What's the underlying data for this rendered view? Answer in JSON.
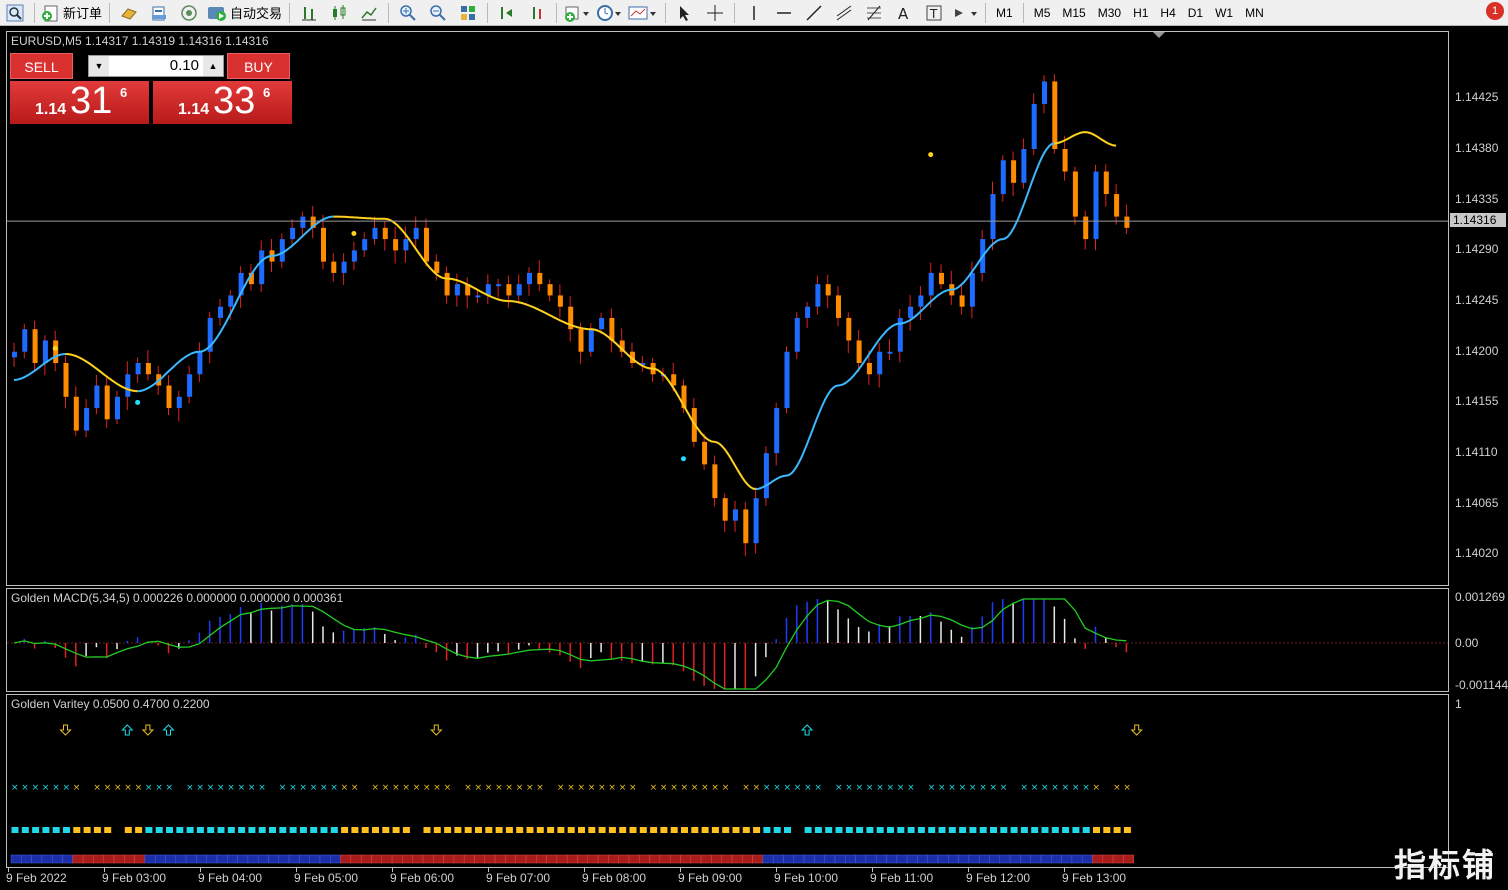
{
  "toolbar": {
    "new_order_label": "新订单",
    "auto_trading_label": "自动交易",
    "timeframes": [
      "M1",
      "M5",
      "M15",
      "M30",
      "H1",
      "H4",
      "D1",
      "W1",
      "MN"
    ],
    "notification_count": "1",
    "colors": {
      "background": "#f0f0f0",
      "badge": "#d93025"
    }
  },
  "chart": {
    "title": "EURUSD,M5  1.14317 1.14319 1.14316 1.14316",
    "current_price": "1.14316",
    "price_labels": [
      "1.14425",
      "1.14380",
      "1.14335",
      "1.14290",
      "1.14245",
      "1.14200",
      "1.14155",
      "1.14110",
      "1.14065",
      "1.14020"
    ],
    "colors": {
      "bull": "#1e6bff",
      "bear": "#ff8c00",
      "wick": "#e0231d",
      "ma_up": "#3cb8ff",
      "ma_down": "#ffd21e"
    }
  },
  "trade_panel": {
    "sell_label": "SELL",
    "buy_label": "BUY",
    "volume": "0.10",
    "sell_small": "1.14",
    "sell_big": "31",
    "sell_sup": "6",
    "buy_small": "1.14",
    "buy_big": "33",
    "buy_sup": "6"
  },
  "macd": {
    "title": "Golden MACD(5,34,5) 0.000226 0.000000 0.000000 0.000361",
    "labels": [
      "0.001269",
      "0.00",
      "-0.001144"
    ]
  },
  "variety": {
    "title": "Golden Varitey 0.0500 0.4700 0.2200",
    "scale_label": "1"
  },
  "time_axis": {
    "labels": [
      "9 Feb 2022",
      "9 Feb 03:00",
      "9 Feb 04:00",
      "9 Feb 05:00",
      "9 Feb 06:00",
      "9 Feb 07:00",
      "9 Feb 08:00",
      "9 Feb 09:00",
      "9 Feb 10:00",
      "9 Feb 11:00",
      "9 Feb 12:00",
      "9 Feb 13:00"
    ]
  },
  "watermark": "指标铺",
  "chart_data": {
    "type": "candlestick",
    "symbol": "EURUSD",
    "timeframe": "M5",
    "y_range": [
      1.14,
      1.14475
    ],
    "closes": [
      1.142,
      1.1422,
      1.1419,
      1.1421,
      1.1419,
      1.1416,
      1.1413,
      1.1415,
      1.1417,
      1.1414,
      1.1416,
      1.1418,
      1.1419,
      1.1418,
      1.1417,
      1.1415,
      1.1416,
      1.1418,
      1.142,
      1.1423,
      1.1424,
      1.1425,
      1.1427,
      1.1426,
      1.1429,
      1.1428,
      1.143,
      1.1431,
      1.1432,
      1.1431,
      1.1428,
      1.1427,
      1.1428,
      1.1429,
      1.143,
      1.1431,
      1.143,
      1.1429,
      1.143,
      1.1431,
      1.1428,
      1.1427,
      1.1425,
      1.1426,
      1.1425,
      1.1425,
      1.1426,
      1.1426,
      1.1425,
      1.1426,
      1.1427,
      1.1426,
      1.1425,
      1.1424,
      1.1422,
      1.142,
      1.1422,
      1.1423,
      1.1421,
      1.142,
      1.1419,
      1.1419,
      1.1418,
      1.1418,
      1.1417,
      1.1415,
      1.1412,
      1.141,
      1.1407,
      1.1405,
      1.1406,
      1.1403,
      1.1407,
      1.1411,
      1.1415,
      1.142,
      1.1423,
      1.1424,
      1.1426,
      1.1425,
      1.1423,
      1.1421,
      1.1419,
      1.1418,
      1.142,
      1.142,
      1.1423,
      1.1424,
      1.1425,
      1.1427,
      1.1426,
      1.1425,
      1.1424,
      1.1427,
      1.143,
      1.1434,
      1.1437,
      1.1435,
      1.1438,
      1.1442,
      1.1444,
      1.1438,
      1.1436,
      1.1432,
      1.143,
      1.1436,
      1.1434,
      1.1432,
      1.1431
    ],
    "ma_curve": [
      [
        0,
        1.14175
      ],
      [
        5,
        1.14198
      ],
      [
        12,
        1.14165
      ],
      [
        18,
        1.142
      ],
      [
        25,
        1.14285
      ],
      [
        31,
        1.1432
      ],
      [
        36,
        1.14318
      ],
      [
        42,
        1.14265
      ],
      [
        48,
        1.14245
      ],
      [
        56,
        1.1422
      ],
      [
        62,
        1.14185
      ],
      [
        68,
        1.1412
      ],
      [
        72,
        1.14078
      ],
      [
        75,
        1.1409
      ],
      [
        80,
        1.1417
      ],
      [
        86,
        1.14225
      ],
      [
        91,
        1.14255
      ],
      [
        96,
        1.143
      ],
      [
        101,
        1.14385
      ],
      [
        104,
        1.14395
      ],
      [
        107,
        1.14383
      ]
    ],
    "ma_color_segments": [
      [
        0,
        5,
        "up"
      ],
      [
        5,
        12,
        "down"
      ],
      [
        12,
        31,
        "up"
      ],
      [
        31,
        72,
        "down"
      ],
      [
        72,
        101,
        "up"
      ],
      [
        101,
        107,
        "down"
      ]
    ],
    "signal_dots": [
      [
        4,
        1.14203,
        "down"
      ],
      [
        12,
        1.14155,
        "up"
      ],
      [
        33,
        1.14305,
        "down"
      ],
      [
        65,
        1.14105,
        "up"
      ],
      [
        89,
        1.14375,
        "down"
      ]
    ]
  }
}
